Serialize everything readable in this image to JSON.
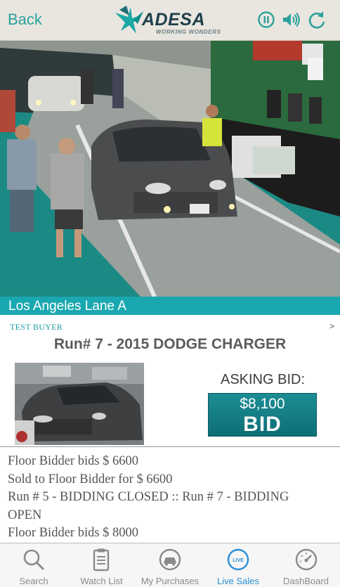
{
  "header": {
    "back_label": "Back",
    "logo_text": "ADESA",
    "logo_tagline": "WORKING WONDERS",
    "icons": [
      "pause-icon",
      "speaker-icon",
      "refresh-icon"
    ],
    "accent_color": "#2aa19a"
  },
  "video": {
    "lane_label": "Los Angeles Lane A"
  },
  "auction": {
    "buyer_label": "TEST BUYER",
    "run_title": "Run# 7 - 2015 DODGE CHARGER",
    "asking_label": "ASKING BID:",
    "bid_amount": "$8,100",
    "bid_label": "BID"
  },
  "log": [
    "Floor Bidder bids $ 6600",
    "Sold to Floor Bidder for $ 6600",
    "Run # 5 - BIDDING CLOSED :: Run # 7 - BIDDING",
    "OPEN",
    "Floor Bidder bids $ 8000"
  ],
  "tabs": [
    {
      "label": "Search",
      "icon": "search-icon"
    },
    {
      "label": "Watch List",
      "icon": "clipboard-icon"
    },
    {
      "label": "My Purchases",
      "icon": "car-icon"
    },
    {
      "label": "Live Sales",
      "icon": "live-icon",
      "icon_text": "LIVE",
      "active": true
    },
    {
      "label": "DashBoard",
      "icon": "gauge-icon"
    }
  ]
}
